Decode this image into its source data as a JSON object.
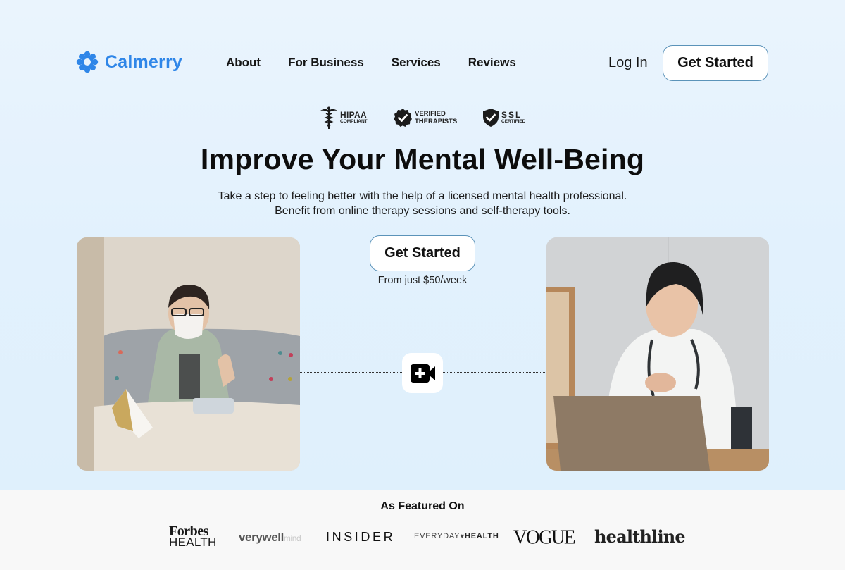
{
  "brand": {
    "name": "Calmerry",
    "color": "#2f86e8",
    "icon": "flower-logo-icon"
  },
  "nav": {
    "items": [
      {
        "label": "About"
      },
      {
        "label": "For Business"
      },
      {
        "label": "Services"
      },
      {
        "label": "Reviews"
      }
    ],
    "login_label": "Log In",
    "cta_label": "Get Started"
  },
  "badges": [
    {
      "icon": "caduceus-icon",
      "title": "HIPAA",
      "subtitle": "COMPLIANT"
    },
    {
      "icon": "verified-check-icon",
      "title": "VERIFIED",
      "subtitle": "THERAPISTS"
    },
    {
      "icon": "shield-check-icon",
      "title": "SSL",
      "subtitle": "CERTIFIED"
    }
  ],
  "hero": {
    "headline": "Improve Your Mental Well-Being",
    "subtitle_line1": "Take a step to feeling better with the help of a licensed mental health professional.",
    "subtitle_line2": "Benefit from online therapy sessions and self-therapy tools.",
    "cta_label": "Get Started",
    "price_note": "From just $50/week",
    "left_photo": "client-on-tablet-photo",
    "right_photo": "therapist-on-laptop-photo",
    "connector_icon": "video-plus-icon"
  },
  "featured": {
    "title": "As Featured On",
    "logos": [
      {
        "line1": "Forbes",
        "line2": "HEALTH"
      },
      {
        "main": "verywell",
        "suffix": "mind"
      },
      {
        "text": "INSIDER"
      },
      {
        "part1": "EVERYDAY",
        "part2": "HEALTH"
      },
      {
        "text": "VOGUE"
      },
      {
        "text": "healthline"
      }
    ]
  }
}
